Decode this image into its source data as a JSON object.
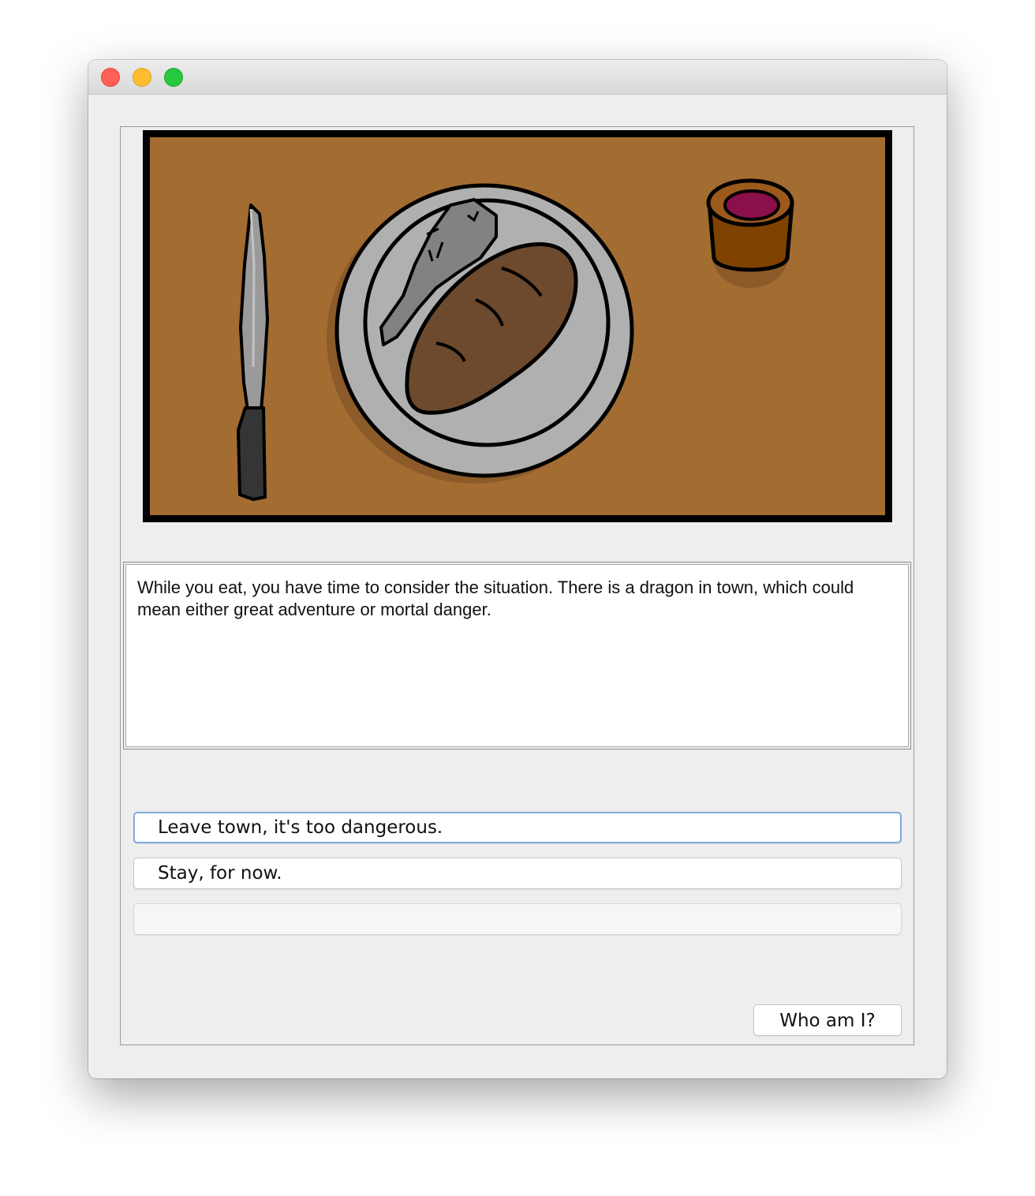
{
  "window": {
    "controls": [
      "close",
      "minimize",
      "zoom"
    ]
  },
  "scene": {
    "icons": [
      "knife-icon",
      "plate-icon",
      "bread-icon",
      "drumstick-icon",
      "cup-icon"
    ],
    "colors": {
      "table": "#a36c31",
      "frame": "#000000",
      "plate": "#b0b0b0",
      "bread": "#6d4a2d",
      "cup": "#7f4201",
      "drink": "#8a0f4a"
    }
  },
  "story": {
    "text": "While you eat, you have time to consider the situation. There is a dragon in town, which could mean either great adventure or mortal danger."
  },
  "choices": [
    {
      "label": "Leave town, it's too dangerous."
    },
    {
      "label": "Stay, for now."
    },
    {
      "label": ""
    }
  ],
  "who_button": {
    "label": "Who am I?"
  }
}
